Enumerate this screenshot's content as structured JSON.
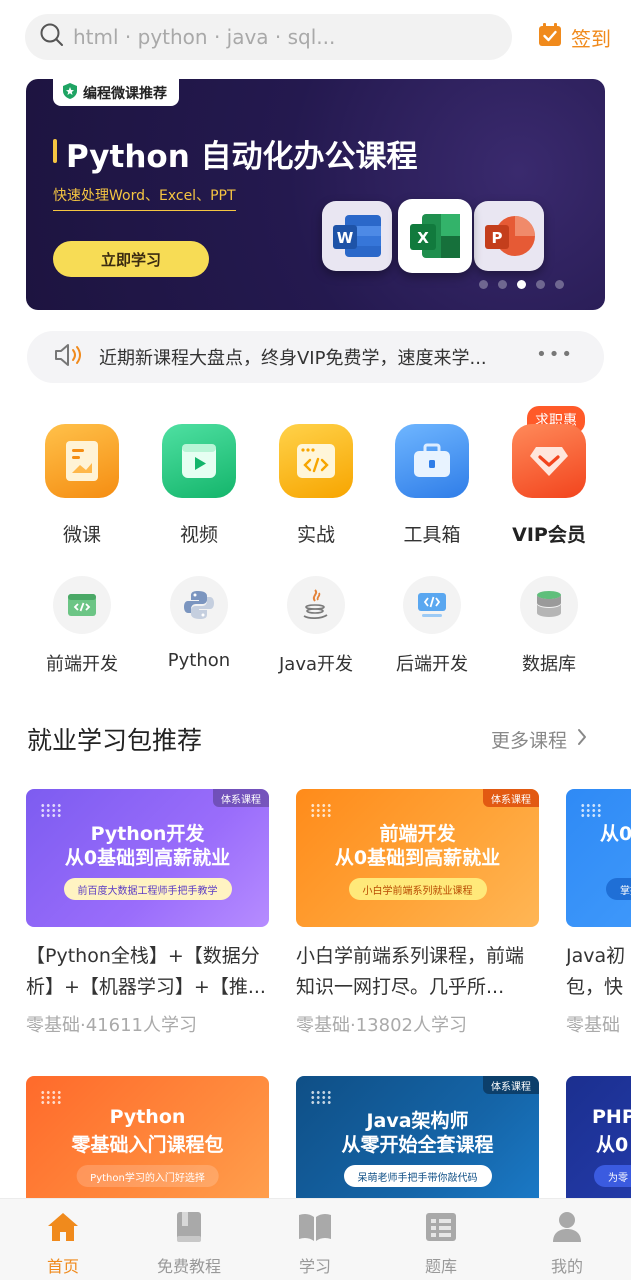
{
  "search": {
    "placeholder": "html · python · java · sql..."
  },
  "checkin": {
    "label": "签到"
  },
  "banner": {
    "tag": "编程微课推荐",
    "title": "Python 自动化办公课程",
    "subtitle": "快速处理Word、Excel、PPT",
    "cta": "立即学习",
    "apps": [
      "W",
      "X",
      "P"
    ],
    "slide_count": 5,
    "active_slide": 3
  },
  "notice": {
    "text": "近期新课程大盘点，终身VIP免费学，速度来学...",
    "more": "•••"
  },
  "main_nav": [
    {
      "label": "微课",
      "icon": "document-icon",
      "color": "#f7a21b"
    },
    {
      "label": "视频",
      "icon": "video-icon",
      "color": "#1fc27a"
    },
    {
      "label": "实战",
      "icon": "code-window-icon",
      "color": "#f9b208"
    },
    {
      "label": "工具箱",
      "icon": "toolbox-icon",
      "color": "#3b8cf0"
    },
    {
      "label": "VIP会员",
      "icon": "diamond-icon",
      "color": "#ff5a29",
      "badge": "求职惠"
    }
  ],
  "categories": [
    {
      "label": "前端开发",
      "icon": "frontend-icon"
    },
    {
      "label": "Python",
      "icon": "python-icon"
    },
    {
      "label": "Java开发",
      "icon": "java-icon"
    },
    {
      "label": "后端开发",
      "icon": "backend-icon"
    },
    {
      "label": "数据库",
      "icon": "database-icon"
    }
  ],
  "section": {
    "title": "就业学习包推荐",
    "more": "更多课程"
  },
  "courses_row1": [
    {
      "kind": "体系课程",
      "line1": "Python开发",
      "line2": "从0基础到高薪就业",
      "pill": "前百度大数据工程师手把手教学",
      "desc": "【Python全栈】+【数据分析】+【机器学习】+【推...",
      "meta": "零基础·41611人学习",
      "theme": "purple"
    },
    {
      "kind": "体系课程",
      "line1": "前端开发",
      "line2": "从0基础到高薪就业",
      "pill": "小白学前端系列就业课程",
      "desc": "小白学前端系列课程，前端知识一网打尽。几乎所...",
      "meta": "零基础·13802人学习",
      "theme": "orange"
    },
    {
      "kind": "",
      "line1": "从0",
      "line2": "",
      "pill": "掌握",
      "desc": "Java初包，快运",
      "meta": "零基础",
      "theme": "blue"
    }
  ],
  "courses_row2": [
    {
      "kind": "",
      "line1": "Python",
      "line2": "零基础入门课程包",
      "pill": "Python学习的入门好选择",
      "theme": "orange2"
    },
    {
      "kind": "体系课程",
      "line1": "Java架构师",
      "line2": "从零开始全套课程",
      "pill": "呆萌老师手把手带你敲代码",
      "theme": "navy"
    },
    {
      "kind": "",
      "line1": "PHP",
      "line2": "从0",
      "pill": "为零",
      "theme": "navy2"
    }
  ],
  "tabs": [
    {
      "label": "首页",
      "icon": "home-icon",
      "active": true
    },
    {
      "label": "免费教程",
      "icon": "book-icon",
      "active": false
    },
    {
      "label": "学习",
      "icon": "open-book-icon",
      "active": false
    },
    {
      "label": "题库",
      "icon": "question-bank-icon",
      "active": false
    },
    {
      "label": "我的",
      "icon": "user-icon",
      "active": false
    }
  ],
  "colors": {
    "accent": "#f08a1c",
    "banner_bg": "#1d1440",
    "banner_highlight": "#f5c542"
  }
}
